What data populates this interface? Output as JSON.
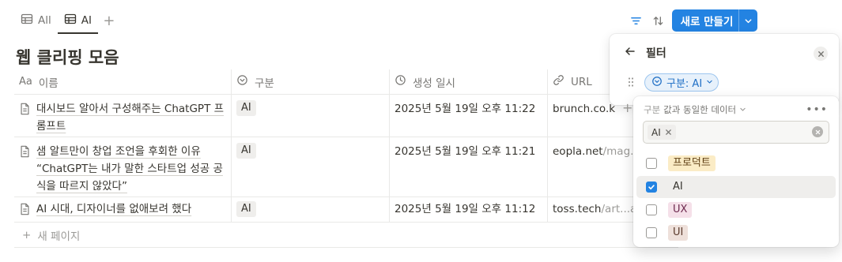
{
  "views": [
    {
      "label": "All",
      "active": false
    },
    {
      "label": "AI",
      "active": true
    }
  ],
  "toolbar": {
    "new_label": "새로 만들기",
    "icons": [
      "filter-icon",
      "sort-icon",
      "lightning-icon",
      "search-icon",
      "expand-icon",
      "more-icon"
    ]
  },
  "page": {
    "title": "웹 클리핑 모음"
  },
  "table": {
    "columns": [
      {
        "label": "이름",
        "icon": "Aa"
      },
      {
        "label": "구분",
        "icon": "select-icon"
      },
      {
        "label": "생성 일시",
        "icon": "clock-icon"
      },
      {
        "label": "URL",
        "icon": "link-icon"
      }
    ],
    "rows": [
      {
        "name": "대시보드 알아서 구성해주는 ChatGPT 프롬프트",
        "category": "AI",
        "created": "2025년 5월 19일 오후 11:22",
        "url_main": "brunch.co.k",
        "url_rest": ""
      },
      {
        "name": "샘 알트만이 창업 조언을 후회한 이유 “ChatGPT는 내가 말한 스타트업 성공 공식을 따르지 않았다”",
        "category": "AI",
        "created": "2025년 5월 19일 오후 11:21",
        "url_main": "eopla.net",
        "url_rest": "/mag..."
      },
      {
        "name": "AI 시대, 디자이너를 없애보려 했다",
        "category": "AI",
        "created": "2025년 5월 19일 오후 11:12",
        "url_main": "toss.tech",
        "url_rest": "/art...ai"
      }
    ],
    "new_row_label": "새 페이지"
  },
  "filter_panel": {
    "title": "필터",
    "chip_label": "구분: AI"
  },
  "dropdown": {
    "property": "구분",
    "condition": "값과 동일한 데이터",
    "selected_chip": "AI",
    "options": [
      {
        "label": "프로덕트",
        "checked": false,
        "color": "#fbecc6"
      },
      {
        "label": "AI",
        "checked": true,
        "color": "#efeeec"
      },
      {
        "label": "UX",
        "checked": false,
        "color": "#f5e0e9"
      },
      {
        "label": "UI",
        "checked": false,
        "color": "#eee0da"
      }
    ]
  },
  "colors": {
    "accent": "#2383e2",
    "text": "#37352f",
    "muted": "#787774"
  }
}
